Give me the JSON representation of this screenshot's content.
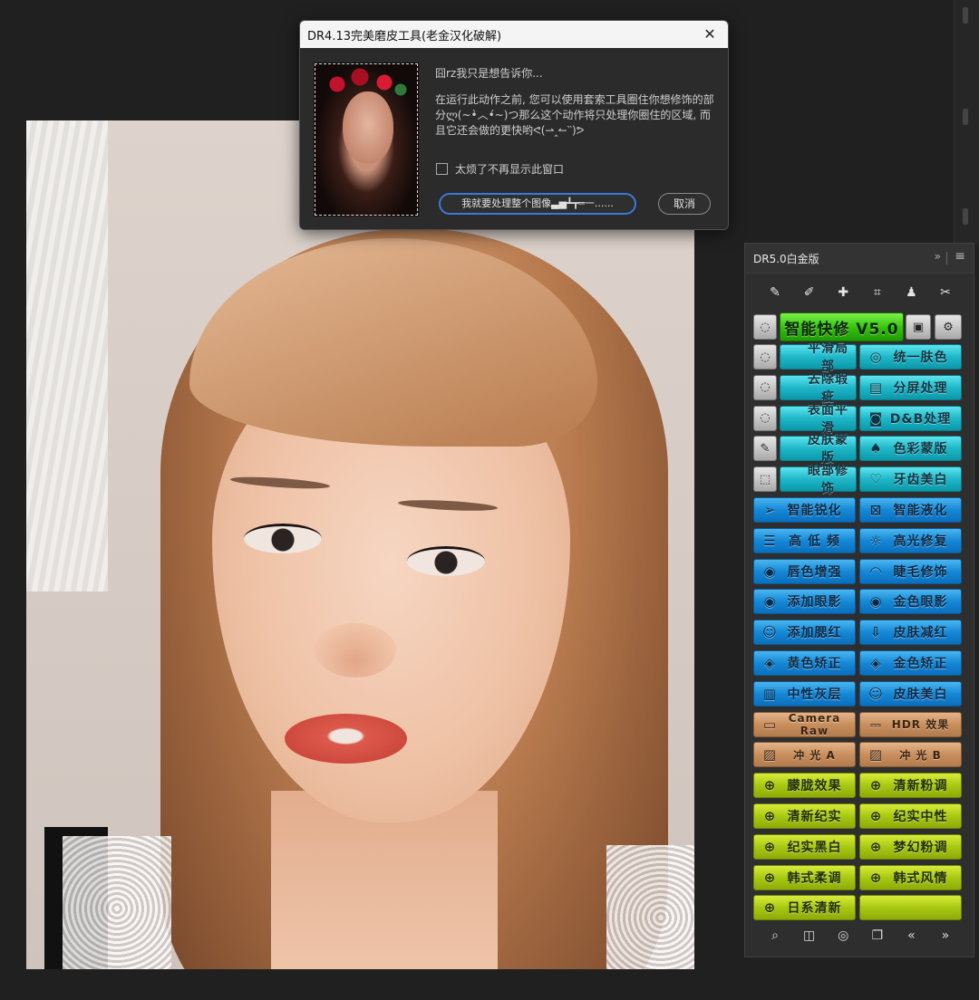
{
  "dialog": {
    "title": "DR4.13完美磨皮工具(老金汉化破解)",
    "close_glyph": "✕",
    "greeting": "囧rz我只是想告诉你...",
    "message": "在运行此动作之前, 您可以使用套索工具圈住你想修饰的部分ლ(~•̀︿•́~)つ那么这个动作将只处理你圈住的区域, 而且它还会做的更快哟ᕙ(⇀‸↼‵‵)ᕗ",
    "checkbox_label": "太烦了不再显示此窗口",
    "process_button": "我就要处理整个图像▃▅┻┳═一......",
    "cancel_button": "取消"
  },
  "panel": {
    "title": "DR5.0白金版",
    "collapse_glyph": "»",
    "menu_glyph": "≡",
    "tool_icons": [
      "✎",
      "✐",
      "✚",
      "⌗",
      "♟",
      "✂"
    ],
    "quick_fix": {
      "label": "智能快修 V5.0",
      "left_glyph": "◌",
      "right1_glyph": "▣",
      "right2_glyph": "⚙"
    },
    "teal_rows": [
      {
        "side_glyph": "◌",
        "left": {
          "icon": "",
          "label": "平滑局部"
        },
        "right": {
          "icon": "◎",
          "label": "统一肤色"
        }
      },
      {
        "side_glyph": "◌",
        "left": {
          "icon": "",
          "label": "去除瑕疵"
        },
        "right": {
          "icon": "▤",
          "label": "分屏处理"
        }
      },
      {
        "side_glyph": "◌",
        "left": {
          "icon": "",
          "label": "表面平滑"
        },
        "right": {
          "icon": "◙",
          "label": "D&B处理"
        }
      },
      {
        "side_glyph": "✎",
        "left": {
          "icon": "",
          "label": "皮肤蒙版"
        },
        "right": {
          "icon": "♠",
          "label": "色彩蒙版"
        }
      },
      {
        "side_glyph": "⬚",
        "left": {
          "icon": "",
          "label": "眼部修饰"
        },
        "right": {
          "icon": "♡",
          "label": "牙齿美白"
        }
      }
    ],
    "blue_rows": [
      {
        "left": {
          "icon": "➢",
          "label": "智能锐化"
        },
        "right": {
          "icon": "⊠",
          "label": "智能液化"
        }
      },
      {
        "left": {
          "icon": "☰",
          "label": "高 低 频"
        },
        "right": {
          "icon": "☼",
          "label": "高光修复"
        }
      },
      {
        "left": {
          "icon": "◉",
          "label": "唇色增强"
        },
        "right": {
          "icon": "◠",
          "label": "睫毛修饰"
        }
      },
      {
        "left": {
          "icon": "◉",
          "label": "添加眼影"
        },
        "right": {
          "icon": "◉",
          "label": "金色眼影"
        }
      },
      {
        "left": {
          "icon": "☺",
          "label": "添加腮红"
        },
        "right": {
          "icon": "⇩",
          "label": "皮肤减红"
        }
      },
      {
        "left": {
          "icon": "◈",
          "label": "黄色矫正"
        },
        "right": {
          "icon": "◈",
          "label": "金色矫正"
        }
      },
      {
        "left": {
          "icon": "▥",
          "label": "中性灰层"
        },
        "right": {
          "icon": "☺",
          "label": "皮肤美白"
        }
      }
    ],
    "tan_rows": [
      {
        "left": {
          "icon": "▭",
          "label": "Camera Raw"
        },
        "right": {
          "icon": "⎓",
          "label": "HDR 效果"
        }
      },
      {
        "left": {
          "icon": "▨",
          "label": "冲 光 A"
        },
        "right": {
          "icon": "▨",
          "label": "冲 光 B"
        }
      }
    ],
    "lime_rows": [
      {
        "left": {
          "icon": "⊕",
          "label": "朦胧效果"
        },
        "right": {
          "icon": "⊕",
          "label": "清新粉调"
        }
      },
      {
        "left": {
          "icon": "⊕",
          "label": "清新纪实"
        },
        "right": {
          "icon": "⊕",
          "label": "纪实中性"
        }
      },
      {
        "left": {
          "icon": "⊕",
          "label": "纪实黑白"
        },
        "right": {
          "icon": "⊕",
          "label": "梦幻粉调"
        }
      },
      {
        "left": {
          "icon": "⊕",
          "label": "韩式柔调"
        },
        "right": {
          "icon": "⊕",
          "label": "韩式风情"
        }
      },
      {
        "left": {
          "icon": "⊕",
          "label": "日系清新"
        },
        "right": {
          "icon": "",
          "label": ""
        }
      }
    ],
    "footer_icons": [
      "⌕",
      "◫",
      "◎",
      "❐",
      "«",
      "»"
    ]
  },
  "colors": {
    "teal": "#1fb7c8",
    "blue": "#1588d6",
    "tan": "#c98f5e",
    "lime": "#a9c812",
    "green": "#37c30e",
    "dialog_bg": "#2b2b2b",
    "app_bg": "#202020",
    "primary_button_border": "#3b78d8"
  }
}
